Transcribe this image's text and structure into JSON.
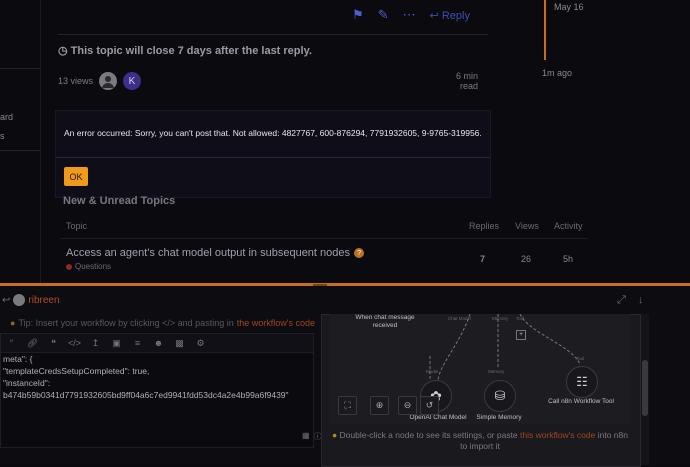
{
  "left_nav": {
    "items": [
      "ard",
      "s"
    ]
  },
  "post": {
    "actions": {
      "reply_label": "Reply"
    },
    "close_notice": "This topic will close 7 days after the last reply.",
    "views": "13 views",
    "avatar_k": "K",
    "read_time": {
      "value": "6 min",
      "unit": "read"
    }
  },
  "timeline": {
    "date": "May 16",
    "ago": "1m ago"
  },
  "error_modal": {
    "message": "An error occurred: Sorry, you can't post that. Not allowed: 4827767, 600-876294, 7791932605, 9-9765-319956.",
    "ok_label": "OK"
  },
  "topic_list": {
    "title": "New & Unread Topics",
    "columns": [
      "Topic",
      "Replies",
      "Views",
      "Activity"
    ],
    "rows": [
      {
        "title": "Access an agent's chat model output in subsequent nodes",
        "category": "Questions",
        "replies": "7",
        "views": "26",
        "activity": "5h"
      }
    ]
  },
  "composer": {
    "reply_to_user": "ribreen",
    "tip": {
      "prefix": "Tip: Insert your workflow by clicking </> and pasting in",
      "link": "the workflow's code"
    },
    "toolbar_icons": [
      "quote-icon",
      "link-icon",
      "blockquote-icon",
      "code-icon",
      "upload-icon",
      "image-icon",
      "list-icon",
      "emoji-icon",
      "calendar-icon",
      "gear-icon"
    ],
    "editor_lines": [
      "meta\": {",
      "\"templateCredsSetupCompleted\": true,",
      "\"instanceId\":",
      "b474b59b0341d7791932605bd9ff04a6c7ed9941fdd53dc4a2e4b99a6f9439\""
    ]
  },
  "preview": {
    "nodes": {
      "trigger": "When chat message received",
      "chat_model": "OpenAI Chat Model",
      "memory": "Simple Memory",
      "tool": "Call n8n Workflow Tool"
    },
    "mini_labels": {
      "chat_model": "Chat Model",
      "memory": "Memory",
      "tool": "Tool",
      "model": "Model"
    },
    "hint": {
      "prefix": "Double-click a node to see its settings, or paste",
      "link": "this workflow's code",
      "suffix": "into n8n to import it"
    }
  },
  "colors": {
    "accent": "#f09a1b",
    "link": "#a1461f",
    "brand": "#c96d1a"
  }
}
